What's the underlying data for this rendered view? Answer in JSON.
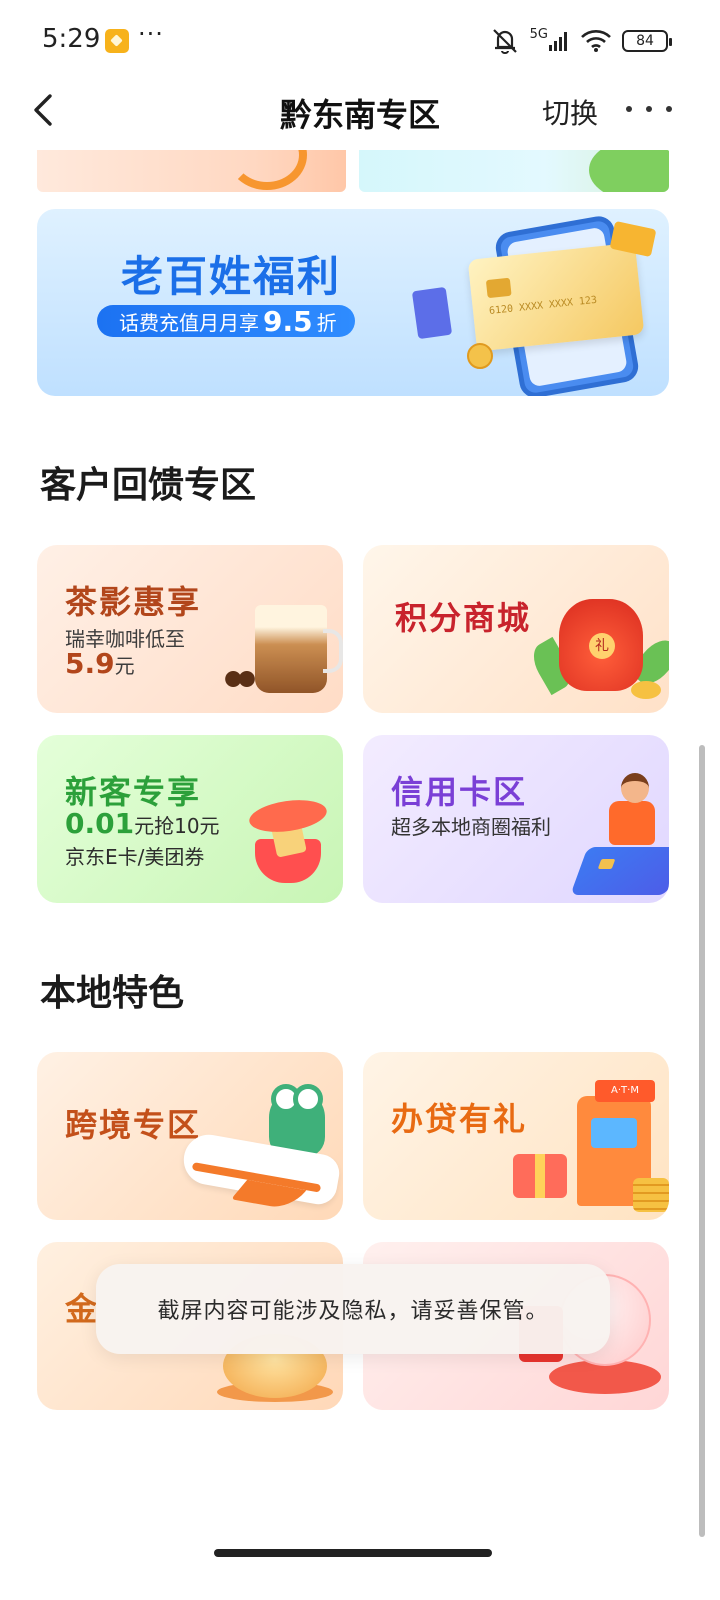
{
  "status_bar": {
    "time": "5:29",
    "more_glyph": "···",
    "network": "5G",
    "battery": "84",
    "icons": [
      "app-notification-icon",
      "mute-icon",
      "signal-icon",
      "wifi-icon",
      "battery-icon"
    ]
  },
  "nav": {
    "title": "黔东南专区",
    "switch_label": "切换",
    "back_icon": "chevron-left-icon",
    "more_icon": "more-dots-icon"
  },
  "welfare_banner": {
    "title": "老百姓福利",
    "pill_prefix": "话费充值月月享",
    "pill_discount": "9.5",
    "pill_suffix": "折",
    "card_number": "6120 XXXX XXXX 123"
  },
  "sections": {
    "feedback": {
      "title": "客户回馈专区",
      "cards": {
        "tea": {
          "title": "茶影惠享",
          "line1": "瑞幸咖啡低至",
          "price": "5.9",
          "unit": "元"
        },
        "points": {
          "title": "积分商城",
          "badge": "礼"
        },
        "new_customer": {
          "title": "新客专享",
          "amount": "0.01",
          "amount_rest": "元抢10元",
          "line2": "京东E卡/美团券"
        },
        "credit": {
          "title": "信用卡区",
          "line1": "超多本地商圈福利"
        }
      }
    },
    "local": {
      "title": "本地特色",
      "cards": {
        "cross_border": {
          "title": "跨境专区"
        },
        "loan": {
          "title": "办贷有礼",
          "atm_label": "A·T·M"
        },
        "gold": {
          "title": "金"
        }
      }
    }
  },
  "toast": {
    "message": "截屏内容可能涉及隐私，请妥善保管。"
  },
  "colors": {
    "accent_blue": "#1b6fe8",
    "tea_brown": "#b2461b",
    "points_red": "#c8232c",
    "new_green": "#2ca03a",
    "credit_purple": "#7a3fd6",
    "cross_orange": "#c3501a",
    "loan_orange": "#e86a12"
  }
}
